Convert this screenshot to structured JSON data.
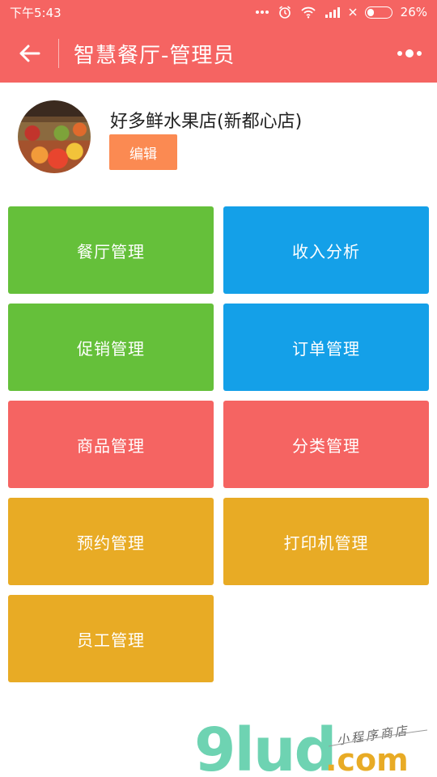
{
  "status": {
    "time": "下午5:43",
    "battery": "26%"
  },
  "nav": {
    "title": "智慧餐厅-管理员"
  },
  "profile": {
    "shop_name": "好多鲜水果店(新都心店)",
    "edit_label": "编辑"
  },
  "tiles": [
    {
      "label": "餐厅管理",
      "color": "#65c03a"
    },
    {
      "label": "收入分析",
      "color": "#14a0e8"
    },
    {
      "label": "促销管理",
      "color": "#65c03a"
    },
    {
      "label": "订单管理",
      "color": "#14a0e8"
    },
    {
      "label": "商品管理",
      "color": "#f56462"
    },
    {
      "label": "分类管理",
      "color": "#f56462"
    },
    {
      "label": "预约管理",
      "color": "#e8ab25"
    },
    {
      "label": "打印机管理",
      "color": "#e8ab25"
    },
    {
      "label": "员工管理",
      "color": "#e8ab25"
    }
  ],
  "watermark": {
    "brand": "9lud",
    "domain": ".com",
    "tagline": "小程序商店"
  }
}
